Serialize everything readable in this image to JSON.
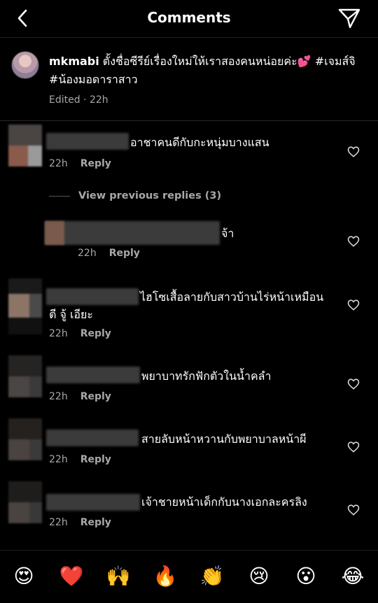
{
  "header": {
    "title": "Comments",
    "back_icon": "chevron-left-icon",
    "send_icon": "paper-plane-icon"
  },
  "caption": {
    "username": "mkmabi",
    "text": " ตั้งชื่อซีรีย์เรื่องใหม่ให้เราสองคนหน่อยค่ะ💕 #เจมส์จิ #น้องมอดาราสาว",
    "meta": "Edited · 22h"
  },
  "reply_label": "Reply",
  "comments": [
    {
      "text": "อาชาคนดีกับกะหนุ่มบางแสน",
      "time": "22h"
    },
    {
      "text": "จ้า",
      "time": "22h"
    },
    {
      "text": "ไฮโซเสื้อลายกับสาวบ้านไร่หน้าเหมือน ตี จู้ เอียะ",
      "time": "22h"
    },
    {
      "text": "พยาบาทรักฟักตัวในน้ำคลำ",
      "time": "22h"
    },
    {
      "text": "สายลับหน้าหวานกับพยาบาลหน้าผี",
      "time": "22h"
    },
    {
      "text": "เจ้าชายหน้าเด็กกับนางเอกละครลิง",
      "time": "22h"
    }
  ],
  "view_previous": "View previous replies (3)",
  "emojis": [
    "😍",
    "❤️",
    "🙌",
    "🔥",
    "👏",
    "😢",
    "😮",
    "😂"
  ]
}
